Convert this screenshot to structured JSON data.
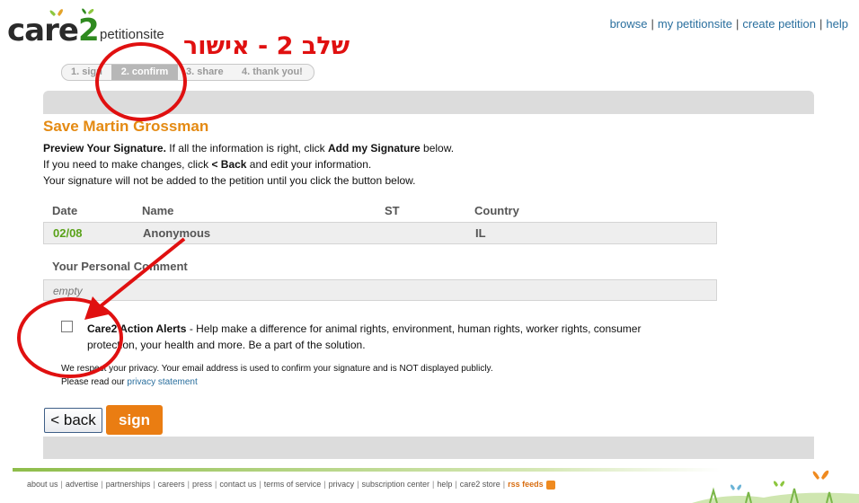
{
  "logo": {
    "brand": "care",
    "brand_num": "2",
    "site": "petitionsite"
  },
  "nav": {
    "links": [
      "browse",
      "my petitionsite",
      "create petition",
      "help"
    ]
  },
  "annotation": {
    "text": "שלב 2 - אישור"
  },
  "steps": [
    "1. sign",
    "2. confirm",
    "3. share",
    "4. thank you!"
  ],
  "petition": {
    "title": "Save Martin Grossman"
  },
  "intro": {
    "line1_bold": "Preview Your Signature.",
    "line1_rest": " If all the information is right, click ",
    "line1_bold2": "Add my Signature",
    "line1_end": " below.",
    "line2_start": "If you need to make changes, click ",
    "line2_bold": "< Back",
    "line2_end": " and edit your information.",
    "line3": "Your signature will not be added to the petition until you click the button below."
  },
  "signature": {
    "headers": {
      "date": "Date",
      "name": "Name",
      "st": "ST",
      "country": "Country"
    },
    "row": {
      "date": "02/08",
      "name": "Anonymous",
      "st": "",
      "country": "IL"
    }
  },
  "comment": {
    "label": "Your Personal Comment",
    "value": "empty"
  },
  "alerts": {
    "bold": "Care2 Action Alerts",
    "text": " - Help make a difference for animal rights, environment, human rights, worker rights, consumer protection, your health and more. Be a part of the solution.",
    "checked": false
  },
  "privacy": {
    "line1": "We respect your privacy. Your email address is used to confirm your signature and is NOT displayed publicly.",
    "line2": "Please read our ",
    "link": "privacy statement"
  },
  "buttons": {
    "back": "< back",
    "sign": "sign"
  },
  "footer": {
    "links": [
      "about us",
      "advertise",
      "partnerships",
      "careers",
      "press",
      "contact us",
      "terms of service",
      "privacy",
      "subscription center",
      "help",
      "care2 store"
    ],
    "rss": "rss feeds"
  },
  "colors": {
    "accent": "#e48a12",
    "link": "#2a6f9e",
    "annotation": "#e01010",
    "button": "#ea7d12"
  }
}
